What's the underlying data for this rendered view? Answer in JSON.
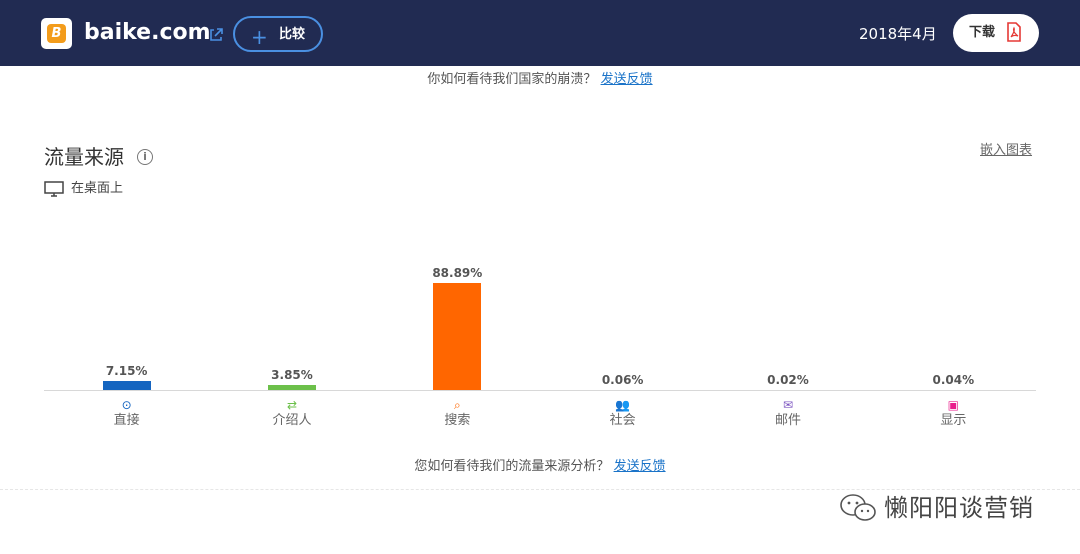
{
  "header": {
    "site_name": "baike.com",
    "logo_letter": "B",
    "compare_plus": "+",
    "compare_label": "比较",
    "date": "2018年4月",
    "download_label": "下载"
  },
  "top_feedback": {
    "question": "你如何看待我们国家的崩溃？",
    "link": "发送反馈"
  },
  "section": {
    "title": "流量来源",
    "info_glyph": "i",
    "embed_link": "嵌入图表",
    "device_label": "在桌面上"
  },
  "chart_data": {
    "type": "bar",
    "categories": [
      "直接",
      "介绍人",
      "搜索",
      "社会",
      "邮件",
      "显示"
    ],
    "values": [
      7.15,
      3.85,
      88.89,
      0.06,
      0.02,
      0.04
    ],
    "value_labels": [
      "7.15%",
      "3.85%",
      "88.89%",
      "0.06%",
      "0.02%",
      "0.04%"
    ],
    "colors": [
      "#1565c0",
      "#6cc04a",
      "#ff6600",
      "#1e88e5",
      "#7e57c2",
      "#e91e8c"
    ],
    "icons": [
      "direct-icon",
      "referral-icon",
      "search-icon",
      "social-icon",
      "mail-icon",
      "display-icon"
    ],
    "ylim": [
      0,
      100
    ],
    "grid": false
  },
  "bottom_feedback": {
    "question": "您如何看待我们的流量来源分析？",
    "link": "发送反馈"
  },
  "watermark": {
    "text": "懒阳阳谈营销"
  }
}
